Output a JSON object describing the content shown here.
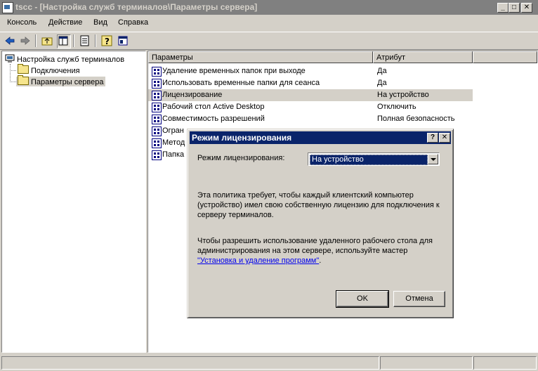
{
  "window": {
    "title": "tscc - [Настройка служб терминалов\\Параметры сервера]",
    "controls": [
      "_",
      "□",
      "✕"
    ]
  },
  "menu": [
    {
      "label": "Консоль"
    },
    {
      "label": "Действие"
    },
    {
      "label": "Вид"
    },
    {
      "label": "Справка"
    }
  ],
  "toolbar": [
    "back-icon",
    "forward-icon",
    "up-folder-icon",
    "show-tree-icon",
    "export-list-icon",
    "help-icon",
    "console-icon"
  ],
  "tree": {
    "root": "Настройка служб терминалов",
    "items": [
      {
        "label": "Подключения",
        "selected": false
      },
      {
        "label": "Параметры сервера",
        "selected": true
      }
    ]
  },
  "list": {
    "columns": [
      "Параметры",
      "Атрибут"
    ],
    "rows": [
      {
        "name": "Удаление временных папок при выходе",
        "attr": "Да"
      },
      {
        "name": "Использовать временные папки для сеанса",
        "attr": "Да"
      },
      {
        "name": "Лицензирование",
        "attr": "На устройство",
        "selected": true
      },
      {
        "name": "Рабочий стол Active Desktop",
        "attr": "Отключить"
      },
      {
        "name": "Совместимость разрешений",
        "attr": "Полная безопасность"
      },
      {
        "name": "Огран",
        "attr": ""
      },
      {
        "name": "Метод",
        "attr": ""
      },
      {
        "name": "Папка",
        "attr": ""
      }
    ]
  },
  "dialog": {
    "title": "Режим лицензирования",
    "controls": [
      "?",
      "✕"
    ],
    "mode_label": "Режим лицензирования:",
    "mode_value": "На устройство",
    "para1": "Эта политика требует, чтобы каждый клиентский компьютер (устройство) имел свою собственную лицензию для подключения к серверу терминалов.",
    "para2": "Чтобы разрешить использование удаленного рабочего стола для администрирования на этом сервере, используйте мастер",
    "link_text": "\"Установка и удаление программ\"",
    "ok_label": "OK",
    "cancel_label": "Отмена"
  }
}
